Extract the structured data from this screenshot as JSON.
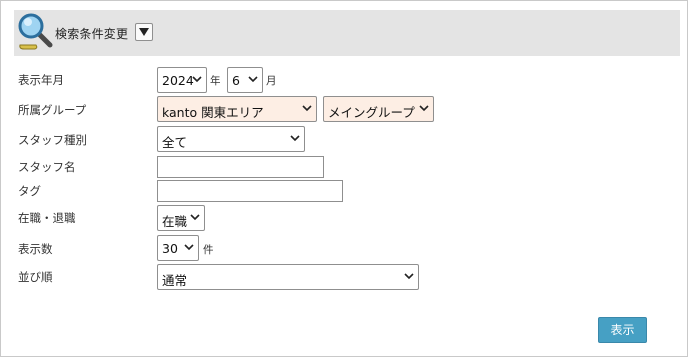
{
  "header": {
    "title": "検索条件変更",
    "toggle_icon": "triangle-down-icon"
  },
  "fields": {
    "year_month": {
      "label": "表示年月",
      "year": "2024",
      "year_unit": "年",
      "month": "6",
      "month_unit": "月"
    },
    "department": {
      "label": "所属グループ",
      "group1": "kanto 関東エリア",
      "group2": "メイングループ"
    },
    "staff_type": {
      "label": "スタッフ種別",
      "value": "全て"
    },
    "staff_name": {
      "label": "スタッフ名",
      "value": ""
    },
    "tag": {
      "label": "タグ",
      "value": ""
    },
    "employment": {
      "label": "在職・退職",
      "value": "在職"
    },
    "display_count": {
      "label": "表示数",
      "value": "30",
      "unit": "件"
    },
    "sort_order": {
      "label": "並び順",
      "value": "通常"
    }
  },
  "submit_label": "表示",
  "colors": {
    "header_bg": "#e4e4e4",
    "select_highlight": "#fdeee4",
    "button": "#46a0c4"
  }
}
